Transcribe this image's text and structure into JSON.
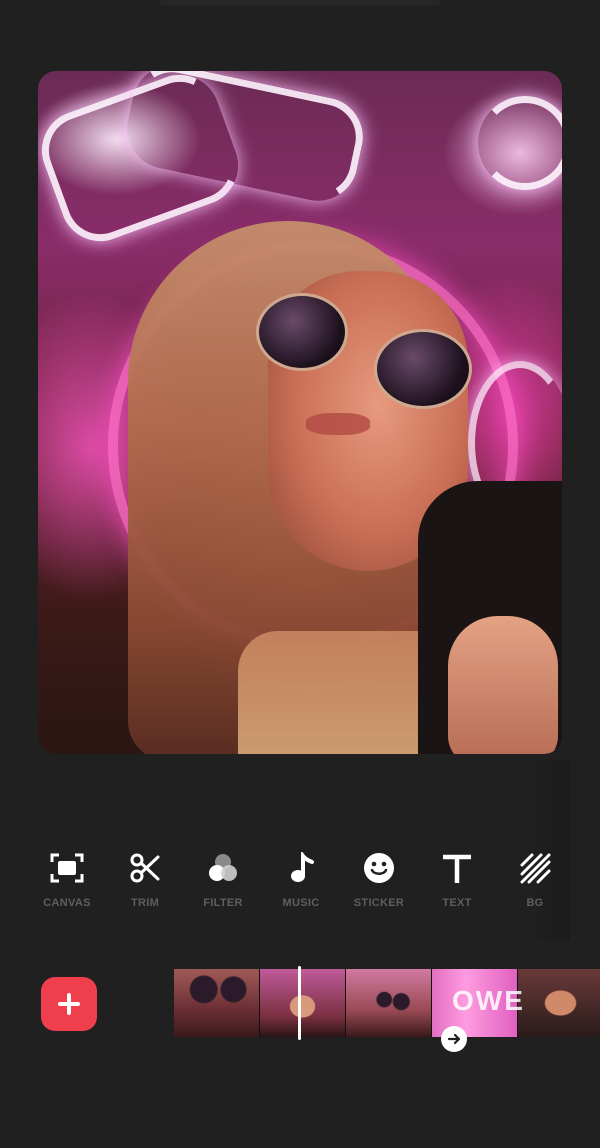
{
  "preview": {
    "description_icon": "photo"
  },
  "toolbar": {
    "items": [
      {
        "label": "CANVAS",
        "icon": "canvas-icon"
      },
      {
        "label": "TRIM",
        "icon": "scissors-icon"
      },
      {
        "label": "FILTER",
        "icon": "filter-icon"
      },
      {
        "label": "MUSIC",
        "icon": "music-note-icon"
      },
      {
        "label": "STICKER",
        "icon": "smiley-icon"
      },
      {
        "label": "TEXT",
        "icon": "text-icon"
      },
      {
        "label": "BG",
        "icon": "stripes-icon"
      }
    ]
  },
  "timeline": {
    "overlay_text": "OWE"
  },
  "colors": {
    "accent": "#ef3f4d",
    "background": "#202020",
    "label": "#5e5e5e"
  }
}
